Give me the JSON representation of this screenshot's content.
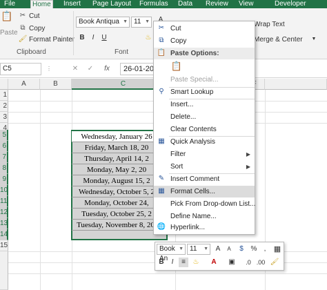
{
  "ribbon": {
    "tabs": [
      "File",
      "Home",
      "Insert",
      "Page Layout",
      "Formulas",
      "Data",
      "Review",
      "View",
      "Developer"
    ],
    "active_tab": "Home",
    "clipboard": {
      "paste": "Paste",
      "cut": "Cut",
      "copy": "Copy",
      "format_painter": "Format Painter",
      "group_label": "Clipboard"
    },
    "font": {
      "name": "Book Antiqua",
      "size": "11",
      "group_label": "Font"
    },
    "alignment": {
      "wrap_text": "Wrap Text",
      "merge_center": "Merge & Center"
    }
  },
  "formula_bar": {
    "name_box": "C5",
    "fx": "fx",
    "value": "26-01-202"
  },
  "columns": [
    "A",
    "B",
    "C",
    "F"
  ],
  "rows": [
    "1",
    "2",
    "3",
    "4",
    "5",
    "6",
    "7",
    "8",
    "9",
    "10",
    "11",
    "12",
    "13",
    "14",
    "15"
  ],
  "cells": [
    "Wednesday, January 26",
    "Friday, March 18, 20",
    "Thursday, April 14, 2",
    "Monday, May 2, 20",
    "Monday, August 15, 2",
    "Wednesday, October 5, 2",
    "Monday, October 24,",
    "Tuesday, October 25, 2",
    "Tuesday, November 8, 2022"
  ],
  "context_menu": {
    "cut": "Cut",
    "copy": "Copy",
    "paste_options": "Paste Options:",
    "paste_special": "Paste Special...",
    "smart_lookup": "Smart Lookup",
    "insert": "Insert...",
    "delete": "Delete...",
    "clear_contents": "Clear Contents",
    "quick_analysis": "Quick Analysis",
    "filter": "Filter",
    "sort": "Sort",
    "insert_comment": "Insert Comment",
    "format_cells": "Format Cells...",
    "pick_dropdown": "Pick From Drop-down List...",
    "define_name": "Define Name...",
    "hyperlink": "Hyperlink..."
  },
  "mini_toolbar": {
    "font": "Book An",
    "size": "11"
  },
  "colors": {
    "excel_green": "#217346",
    "selection_fill": "#d4d4d4"
  }
}
